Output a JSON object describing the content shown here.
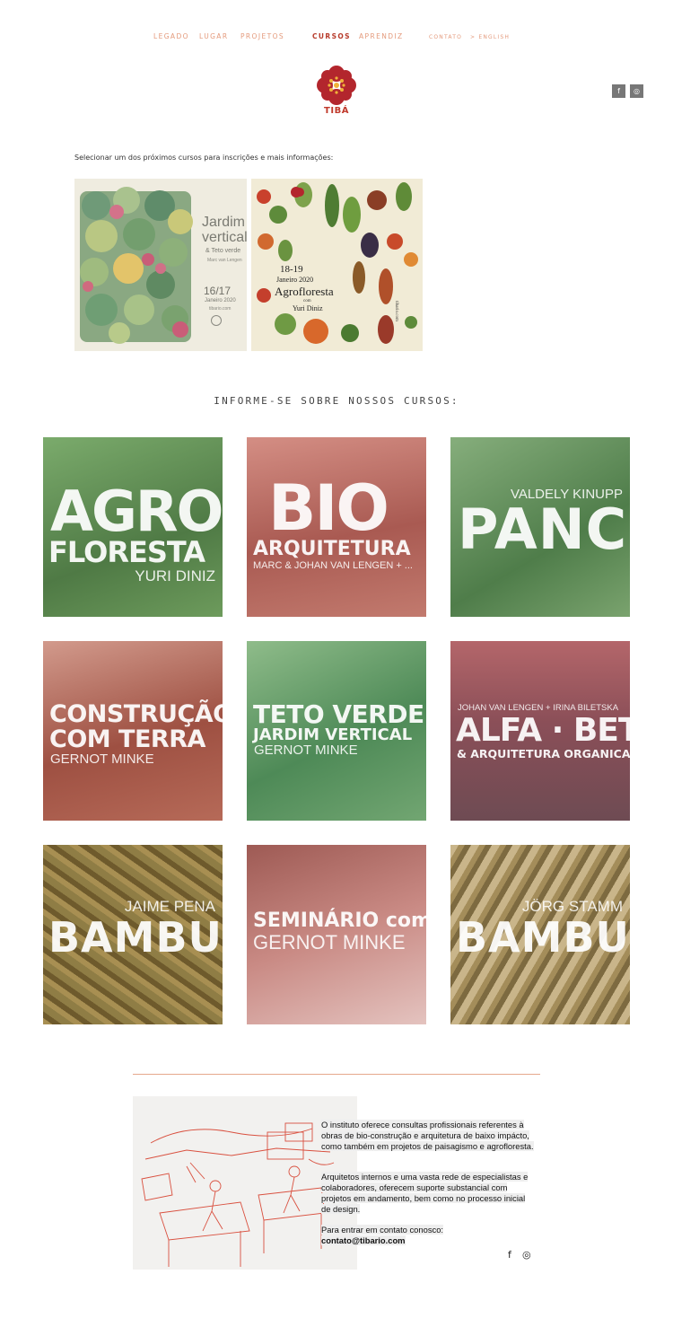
{
  "nav": {
    "legado": "LEGADO",
    "lugar": "LUGAR",
    "projetos": "PROJETOS",
    "cursos": "CURSOS",
    "aprendiz": "APRENDIZ",
    "contato": "CONTATO",
    "english": "> ENGLISH"
  },
  "logo": {
    "text": "TIBÁ"
  },
  "header_social": {
    "facebook": "f",
    "instagram": "◎"
  },
  "intro": "Selecionar um dos próximos cursos para inscrições e mais informações:",
  "posters": [
    {
      "title1": "Jardim",
      "title2": "vertical",
      "sub": "& Teto verde",
      "author": "Marc van Lengen",
      "dates": "16/17",
      "month": "Janeiro 2020",
      "site": "tibario.com"
    },
    {
      "dates": "18-19",
      "month": "Janeiro 2020",
      "title": "Agrofloresta",
      "com": "com",
      "author": "Yuri Diniz",
      "site": "tibario.com"
    }
  ],
  "courses_heading": "INFORME-SE SOBRE NOSSOS CURSOS:",
  "courses": [
    {
      "line1": "AGRO",
      "line2": "FLORESTA",
      "name": "YURI DINIZ",
      "color": "#6a9b5f"
    },
    {
      "line1": "BIO",
      "line2": "ARQUITETURA",
      "name": "MARC & JOHAN VAN LENGEN + ...",
      "color": "#c2746a"
    },
    {
      "top": "VALDELY KINUPP",
      "line1": "PANC",
      "color": "#6d9c65"
    },
    {
      "line1": "CONSTRUÇÃO",
      "line2": "COM TERRA",
      "name": "GERNOT MINKE",
      "color": "#b56556"
    },
    {
      "line1": "TETO VERDE",
      "line2": "JARDIM VERTICAL",
      "name": "GERNOT MINKE",
      "color": "#5e9a64"
    },
    {
      "top": "JOHAN VAN LENGEN + IRINA BILETSKA",
      "line1": "ALFA · BETA",
      "line2": "& ARQUITETURA ORGANICA",
      "color": "#8b4f58"
    },
    {
      "top": "JAIME PENA",
      "line1": "BAMBU",
      "color": "#8f7d45"
    },
    {
      "line1": "SEMINÁRIO com",
      "line2": "GERNOT MINKE",
      "color": "#c98a84"
    },
    {
      "top": "JÖRG STAMM",
      "line1": "BAMBU",
      "color": "#a48d5a"
    }
  ],
  "footer": {
    "p1": "O instituto oferece consultas profissionais referentes à obras de bio-construção e arquitetura de baixo impácto, como também em projetos de paisagismo e agrofloresta.",
    "p2": "Arquitetos internos e uma vasta rede de especialistas e colaboradores, oferecem suporte substancial com projetos em andamento, bem como no processo inicial de design.",
    "p3": "Para entrar em contato conosco:",
    "email": "contato@tibario.com",
    "facebook": "f",
    "instagram": "◎"
  }
}
